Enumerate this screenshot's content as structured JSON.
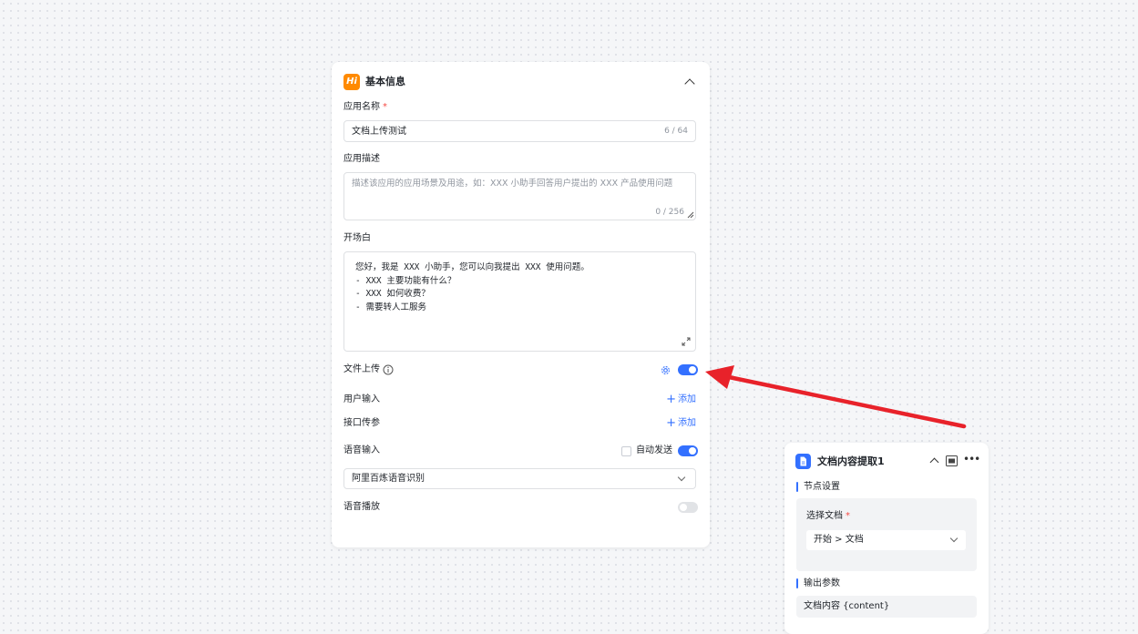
{
  "basic_info": {
    "icon_text": "Hi",
    "title": "基本信息",
    "app_name": {
      "label": "应用名称",
      "required_mark": "*",
      "value": "文档上传测试",
      "counter": "6 / 64"
    },
    "app_desc": {
      "label": "应用描述",
      "placeholder": "描述该应用的应用场景及用途，如：XXX 小助手回答用户提出的 XXX 产品使用问题",
      "counter": "0 / 256"
    },
    "opening": {
      "label": "开场白",
      "lines": [
        "您好，我是 XXX 小助手，您可以向我提出 XXX 使用问题。",
        "- XXX 主要功能有什么？",
        "- XXX 如何收费？",
        "- 需要转人工服务"
      ]
    },
    "file_upload": {
      "label": "文件上传",
      "enabled": true
    },
    "user_input": {
      "label": "用户输入",
      "add_label": "添加"
    },
    "api_params": {
      "label": "接口传参",
      "add_label": "添加"
    },
    "voice_input": {
      "label": "语音输入",
      "auto_send_label": "自动发送",
      "auto_send_checked": false,
      "enabled": true,
      "engine": "阿里百炼语音识别"
    },
    "voice_playback": {
      "label": "语音播放",
      "enabled": false
    }
  },
  "node": {
    "title": "文档内容提取1",
    "node_settings_label": "节点设置",
    "select_doc": {
      "label": "选择文档",
      "required_mark": "*",
      "value": "开始 > 文档"
    },
    "output_label": "输出参数",
    "output_item": "文档内容 {content}"
  },
  "colors": {
    "accent": "#3370ff",
    "brand_orange": "#ff8a00",
    "arrow_red": "#e8222a",
    "required": "#f54a45"
  }
}
